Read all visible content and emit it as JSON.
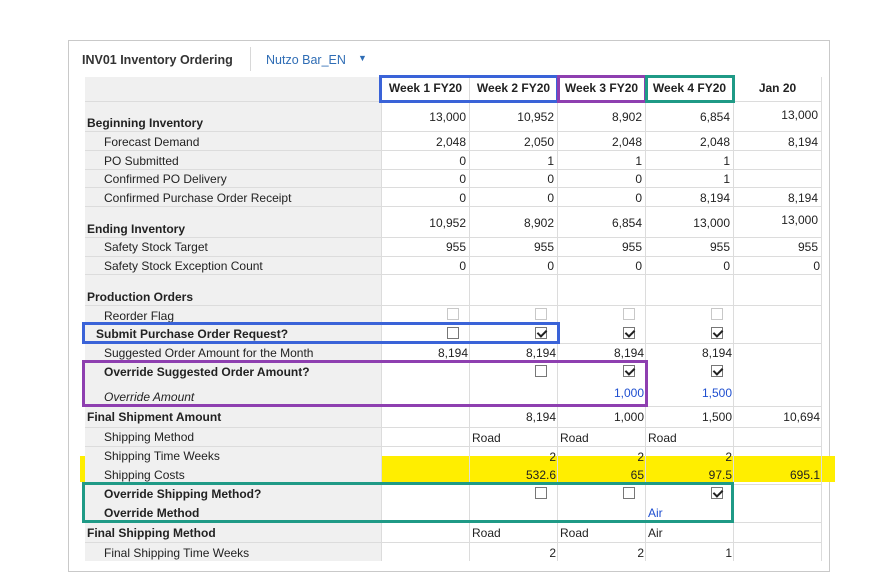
{
  "header": {
    "title": "INV01 Inventory Ordering",
    "version": "Nutzo Bar_EN",
    "caret": "▼"
  },
  "columns": [
    "Week 1 FY20",
    "Week 2 FY20",
    "Week 3 FY20",
    "Week 4 FY20",
    "Jan 20"
  ],
  "rows": {
    "beginning_inventory": {
      "label": "Beginning Inventory",
      "values": [
        "13,000",
        "10,952",
        "8,902",
        "6,854",
        "13,000"
      ]
    },
    "forecast_demand": {
      "label": "Forecast Demand",
      "values": [
        "2,048",
        "2,050",
        "2,048",
        "2,048",
        "8,194"
      ]
    },
    "po_submitted": {
      "label": "PO Submitted",
      "values": [
        "0",
        "1",
        "1",
        "1",
        ""
      ]
    },
    "confirmed_po_delivery": {
      "label": "Confirmed PO Delivery",
      "values": [
        "0",
        "0",
        "0",
        "1",
        ""
      ]
    },
    "confirmed_po_receipt": {
      "label": "Confirmed Purchase Order Receipt",
      "values": [
        "0",
        "0",
        "0",
        "8,194",
        "8,194"
      ]
    },
    "ending_inventory": {
      "label": "Ending Inventory",
      "values": [
        "10,952",
        "8,902",
        "6,854",
        "13,000",
        "13,000"
      ]
    },
    "safety_stock_target": {
      "label": "Safety Stock Target",
      "values": [
        "955",
        "955",
        "955",
        "955",
        "955"
      ]
    },
    "safety_stock_exception": {
      "label": "Safety Stock Exception Count",
      "values": [
        "0",
        "0",
        "0",
        "0",
        "0"
      ]
    },
    "production_orders": {
      "label": "Production Orders"
    },
    "reorder_flag": {
      "label": "Reorder Flag",
      "checked": [
        false,
        false,
        false,
        false
      ]
    },
    "submit_po_request": {
      "label": "Submit Purchase Order Request?",
      "checked": [
        false,
        true,
        true,
        true
      ]
    },
    "suggested_order_amount": {
      "label": "Suggested Order Amount for the Month",
      "values": [
        "8,194",
        "8,194",
        "8,194",
        "8,194"
      ]
    },
    "override_suggested": {
      "label": "Override Suggested Order Amount?",
      "checked": [
        false,
        true,
        true
      ]
    },
    "override_amount": {
      "label": "Override Amount",
      "values": [
        "1,000",
        "1,500"
      ]
    },
    "final_shipment_amount": {
      "label": "Final Shipment Amount",
      "values": [
        "8,194",
        "1,000",
        "1,500",
        "10,694"
      ]
    },
    "shipping_method": {
      "label": "Shipping Method",
      "values": [
        "Road",
        "Road",
        "Road"
      ]
    },
    "shipping_time_weeks": {
      "label": "Shipping Time Weeks",
      "values": [
        "2",
        "2",
        "2"
      ]
    },
    "shipping_costs": {
      "label": "Shipping Costs",
      "values": [
        "532.6",
        "65",
        "97.5",
        "695.1"
      ]
    },
    "override_shipping_method": {
      "label": "Override Shipping Method?",
      "checked": [
        false,
        false,
        true
      ]
    },
    "override_method": {
      "label": "Override Method",
      "values": [
        "Air"
      ]
    },
    "final_shipping_method": {
      "label": "Final Shipping Method",
      "values": [
        "Road",
        "Road",
        "Air"
      ]
    },
    "final_shipping_time_weeks": {
      "label": "Final Shipping Time Weeks",
      "values": [
        "2",
        "2",
        "1"
      ]
    }
  },
  "colors": {
    "blue_box": "#3a63d8",
    "purple_box": "#8e3fb0",
    "green_box": "#1f9a86",
    "highlight": "#ffee00",
    "link": "#2f6db5"
  }
}
